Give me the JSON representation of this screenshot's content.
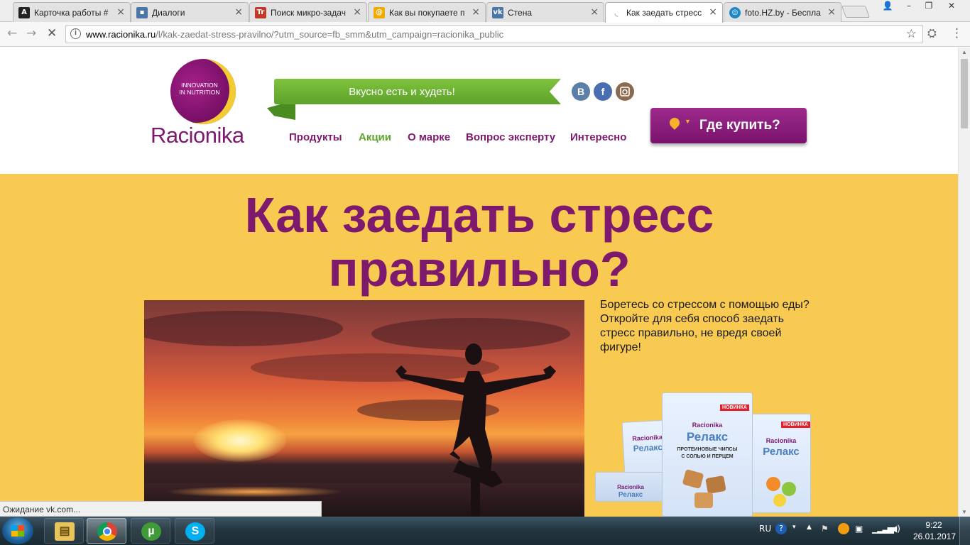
{
  "browser": {
    "tabs": [
      {
        "label": "Карточка работы #",
        "favicon": "letter-a-icon",
        "favicon_text": "A",
        "favicon_color": "#222222",
        "active": false
      },
      {
        "label": "Диалоги",
        "favicon": "vk-chat-icon",
        "favicon_text": "",
        "favicon_color": "#4a76a8",
        "active": false
      },
      {
        "label": "Поиск микро-задач",
        "favicon": "tt-icon",
        "favicon_text": "Tr",
        "favicon_color": "#c0392b",
        "active": false
      },
      {
        "label": "Как вы покупаете п",
        "favicon": "at-sign-icon",
        "favicon_text": "@",
        "favicon_color": "#f2a900",
        "active": false
      },
      {
        "label": "Стена",
        "favicon": "vk-icon",
        "favicon_text": "vk",
        "favicon_color": "#4a76a8",
        "active": false
      },
      {
        "label": "Как заедать стресс",
        "favicon": "loading-icon",
        "favicon_text": "",
        "favicon_color": "#ffffff",
        "active": true
      },
      {
        "label": "foto.HZ.by - Беспла",
        "favicon": "globe-icon",
        "favicon_text": "",
        "favicon_color": "#1e88c7",
        "active": false
      }
    ],
    "address": {
      "host": "www.racionika.ru",
      "path": "/l/kak-zaedat-stress-pravilno/?utm_source=fb_smm&utm_campaign=racionika_public"
    },
    "status_text": "Ожидание vk.com..."
  },
  "site": {
    "logo": {
      "tagline_1": "INNOVATION",
      "tagline_2": "IN NUTRITION",
      "name": "Racionika"
    },
    "slogan": "Вкусно есть и худеть!",
    "social": [
      {
        "name": "vk-icon",
        "text": "В",
        "color": "#5b7fa6"
      },
      {
        "name": "facebook-icon",
        "text": "f",
        "color": "#4a6eb0"
      },
      {
        "name": "instagram-icon",
        "text": "",
        "color": "#8a6a4f"
      }
    ],
    "nav": [
      "Продукты",
      "Акции",
      "О марке",
      "Вопрос эксперту",
      "Интересно"
    ],
    "nav_highlight": "Акции",
    "buy_button": "Где купить?",
    "accent_purple": "#7d1a6e",
    "accent_green": "#5ea32b",
    "hero_bg": "#f8ca52"
  },
  "hero": {
    "headline_line1": "Как заедать стресс",
    "headline_line2": "правильно?",
    "intro": "Боретесь со стрессом с помощью еды? Откройте для себя способ заедать стресс правильно, не вредя своей фигуре!"
  },
  "products": {
    "brand": "Racionika",
    "name": "Релакс",
    "badge": "НОВИНКА",
    "big_pack_subtitle": "ПРОТЕИНОВЫЕ ЧИПСЫ",
    "big_pack_flavor": "С СОЛЬЮ И ПЕРЦЕМ"
  },
  "taskbar": {
    "apps": [
      "file-explorer-icon",
      "chrome-icon",
      "utorrent-icon",
      "skype-icon"
    ],
    "lang": "RU",
    "time": "9:22",
    "date": "26.01.2017"
  }
}
